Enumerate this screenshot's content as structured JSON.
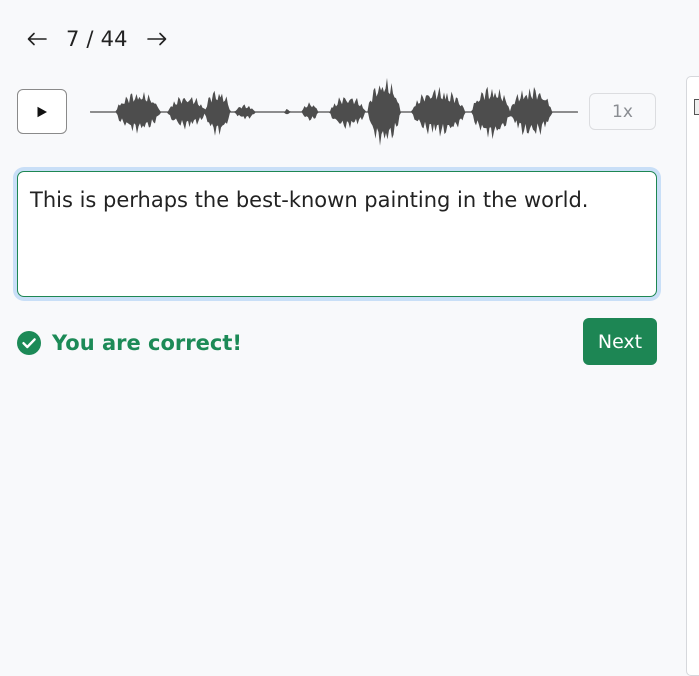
{
  "pager": {
    "current": "7",
    "separator": "/",
    "total": "44",
    "label": "7 / 44",
    "prev_icon": "arrow-left-icon",
    "next_icon": "arrow-right-icon"
  },
  "player": {
    "play_icon": "play-icon",
    "speed_label": "1x"
  },
  "answer": {
    "text": "This is perhaps the best-known painting in the world."
  },
  "result": {
    "icon": "check-circle-icon",
    "message": "You are correct!",
    "color": "#1c8a57"
  },
  "actions": {
    "next_label": "Next",
    "next_color": "#1d8654"
  },
  "colors": {
    "waveform": "#4d4d4d",
    "focus_ring": "#c9dff7",
    "background": "#f8f9fb"
  }
}
